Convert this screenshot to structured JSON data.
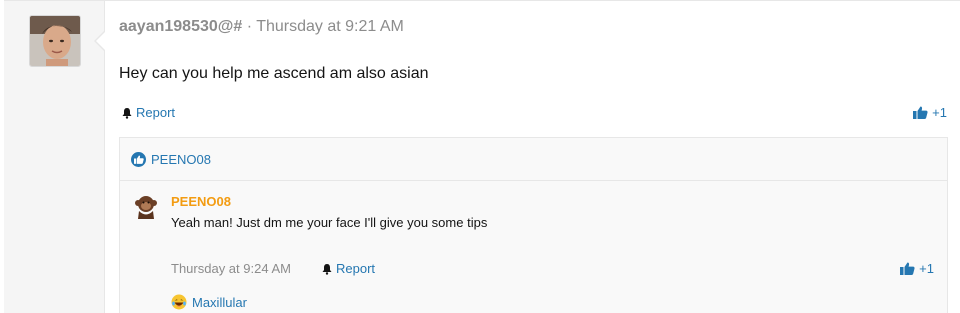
{
  "post": {
    "username": "aayan198530@#",
    "separator": "·",
    "timestamp": "Thursday at 9:21 AM",
    "message": "Hey can you help me ascend am also asian",
    "report_label": "Report",
    "like_count": "+1"
  },
  "reactions": {
    "reactor": "PEENO08"
  },
  "reply": {
    "username": "PEENO08",
    "message": "Yeah man! Just dm me your face I'll give you some tips",
    "timestamp": "Thursday at 9:24 AM",
    "report_label": "Report",
    "like_count": "+1",
    "reactor": "Maxillular"
  },
  "colors": {
    "link": "#2577b1",
    "username_reply": "#f39c12",
    "muted": "#8c8c8c"
  },
  "icons": {
    "report": "bell-icon",
    "like": "thumbs-up-icon",
    "reaction": "like-reaction-icon",
    "laugh": "laughing-emoji-icon"
  }
}
